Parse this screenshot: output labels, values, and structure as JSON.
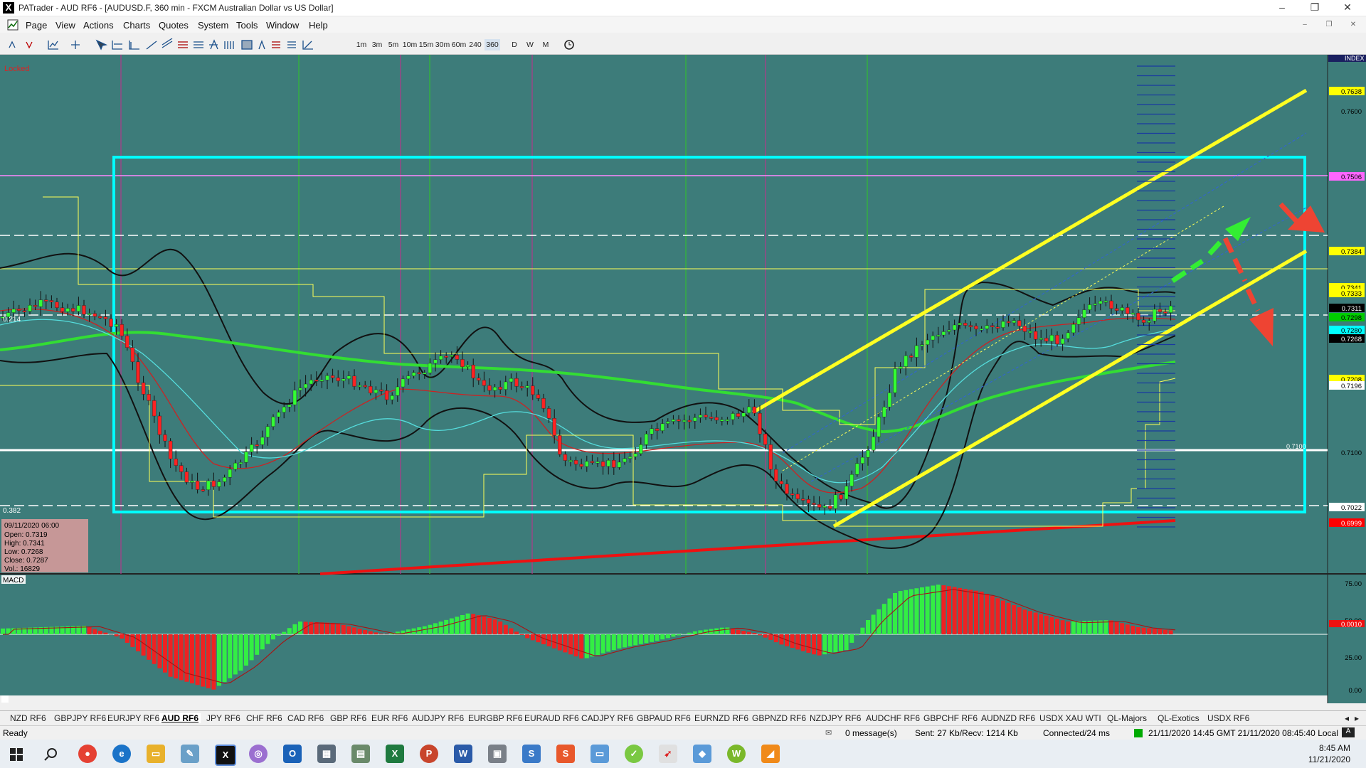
{
  "window": {
    "title": "PATrader - AUD RF6 - [AUDUSD.F, 360 min - FXCM Australian Dollar vs US Dollar]",
    "app_icon": "X",
    "min": "–",
    "max": "❐",
    "close": "✕"
  },
  "menu": [
    "Page",
    "View",
    "Actions",
    "Charts",
    "Quotes",
    "System",
    "Tools",
    "Window",
    "Help"
  ],
  "timeframes": [
    "1m",
    "3m",
    "5m",
    "10m",
    "15m",
    "30m",
    "60m",
    "240",
    "360",
    "D",
    "W",
    "M"
  ],
  "chart": {
    "locked_label": "Locked",
    "index_label": "INDEX",
    "fib_214": "0.214",
    "fib_382": "0.382",
    "level_label": "0.7100",
    "ohlc_box": {
      "date": "09/11/2020 06:00",
      "open": "Open: 0.7319",
      "high": "High: 0.7341",
      "low": "Low: 0.7268",
      "close": "Close: 0.7287",
      "vol": "Vol.: 16829"
    },
    "price_axis": [
      {
        "label": "0.7638",
        "color": "#ffff00",
        "text": "#000"
      },
      {
        "label": "0.7600",
        "color": "",
        "text": "#000"
      },
      {
        "label": "0.7506",
        "color": "#ff66ff",
        "text": "#000"
      },
      {
        "label": "0.7384",
        "color": "#ffff00",
        "text": "#000"
      },
      {
        "label": "0.7341",
        "color": "#ffff00",
        "text": "#000"
      },
      {
        "label": "0.7333",
        "color": "#ffff00",
        "text": "#000"
      },
      {
        "label": "0.7311",
        "color": "#000000",
        "text": "#fff"
      },
      {
        "label": "0.7298",
        "color": "#00cc00",
        "text": "#000"
      },
      {
        "label": "0.7280",
        "color": "#00ffff",
        "text": "#000"
      },
      {
        "label": "0.7268",
        "color": "#000000",
        "text": "#fff"
      },
      {
        "label": "0.7208",
        "color": "#ffff00",
        "text": "#000"
      },
      {
        "label": "0.7196",
        "color": "#ffffff",
        "text": "#000"
      },
      {
        "label": "0.7100",
        "color": "",
        "text": "#000"
      },
      {
        "label": "0.7022",
        "color": "#ffffff",
        "text": "#000"
      },
      {
        "label": "0.6999",
        "color": "#ff0000",
        "text": "#fff"
      }
    ],
    "macd_label": "MACD",
    "macd_axis": [
      "75.00",
      "50.00",
      "0.0010",
      "25.00",
      "0.00"
    ],
    "colors": {
      "bg": "#3d7c7a",
      "up": "#33ff33",
      "down": "#ff2222",
      "channel": "#ffff33",
      "range_box": "#00ffff",
      "ma_long": "#33dd33"
    }
  },
  "tabs": [
    "NZD RF6",
    "GBPJPY RF6",
    "EURJPY RF6",
    "AUD RF6",
    "JPY RF6",
    "CHF RF6",
    "CAD RF6",
    "GBP RF6",
    "EUR RF6",
    "AUDJPY RF6",
    "EURGBP RF6",
    "EURAUD RF6",
    "CADJPY RF6",
    "GBPAUD RF6",
    "EURNZD RF6",
    "GBPNZD RF6",
    "NZDJPY RF6",
    "AUDCHF RF6",
    "GBPCHF RF6",
    "AUDNZD RF6",
    "USDX XAU WTI",
    "QL-Majors",
    "QL-Exotics",
    "USDX RF6"
  ],
  "active_tab": "AUD RF6",
  "status": {
    "ready": "Ready",
    "messages": "0 message(s)",
    "traffic": "Sent: 27 Kb/Recv: 1214 Kb",
    "connection": "Connected/24 ms",
    "times": "21/11/2020 14:45 GMT  21/11/2020 08:45:40 Local"
  },
  "taskbar": {
    "time": "8:45 AM",
    "date": "11/21/2020"
  }
}
